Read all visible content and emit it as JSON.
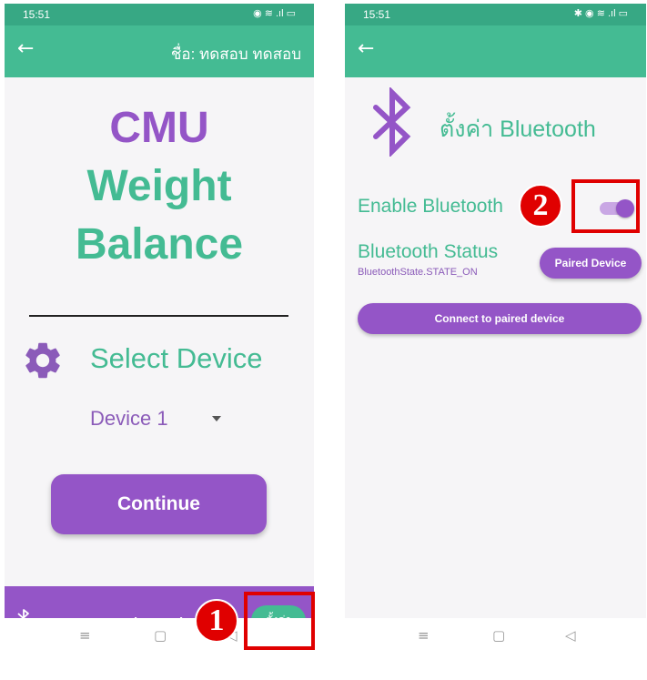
{
  "left_screen": {
    "status_bar": {
      "time": "15:51",
      "icons": "◉ ≋ .ıl ▭"
    },
    "app_bar": {
      "back_icon": "←",
      "title": "ชื่อ: ทดสอบ ทดสอบ"
    },
    "heading": {
      "line1": "CMU",
      "line2": "Weight",
      "line3": "Balance"
    },
    "select_device": {
      "label": "Select Device",
      "icon": "gear-icon"
    },
    "device_dropdown": {
      "value": "Device 1"
    },
    "continue_button": {
      "label": "Continue"
    },
    "bottom_bar": {
      "bluetooth_icon": "bluetooth-icon",
      "status_text": "สถานะ Bluetooth",
      "settings_button": "ตั้งค่า"
    },
    "annotation_badge": "1"
  },
  "right_screen": {
    "status_bar": {
      "time": "15:51",
      "icons": "✱ ◉ ≋ .ıl ▭"
    },
    "app_bar": {
      "back_icon": "←"
    },
    "settings_title": "ตั้งค่า Bluetooth",
    "enable_bluetooth": {
      "label": "Enable Bluetooth",
      "enabled": true
    },
    "bluetooth_status": {
      "label": "Bluetooth Status",
      "value": "BluetoothState.STATE_ON"
    },
    "paired_device_button": "Paired Device",
    "connect_button": "Connect to paired device",
    "annotation_badge": "2"
  },
  "nav_bar": {
    "menu": "≡",
    "home": "▢",
    "back": "◁"
  },
  "colors": {
    "green": "#44bb93",
    "purple": "#9455c7",
    "highlight": "#e00000"
  }
}
